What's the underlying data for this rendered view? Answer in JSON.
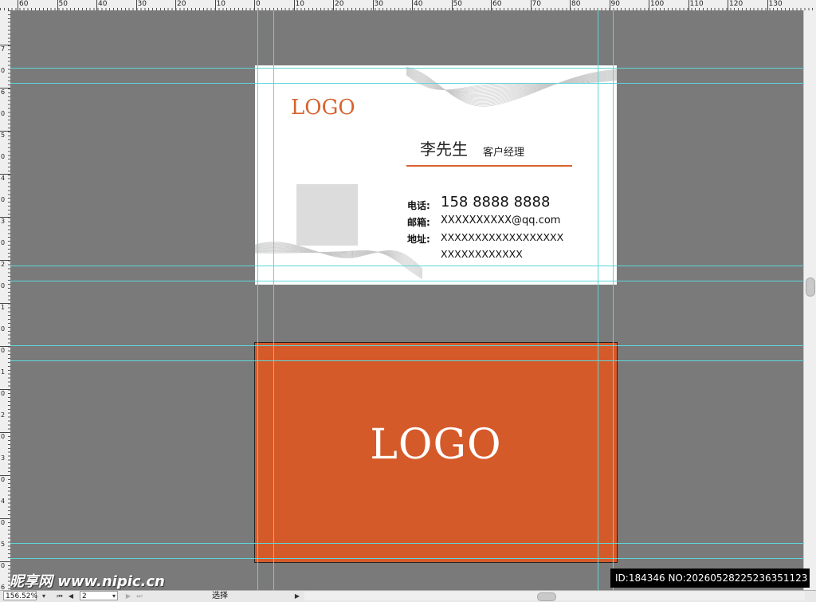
{
  "ruler": {
    "top_numbers": [
      "60",
      "50",
      "40",
      "30",
      "20",
      "10",
      "0",
      "10",
      "20",
      "30",
      "40",
      "50",
      "60",
      "70",
      "80",
      "90",
      "100",
      "110",
      "120",
      "130"
    ],
    "left_numbers": [
      "7",
      "0",
      "6",
      "0",
      "5",
      "0",
      "4",
      "0",
      "3",
      "0",
      "2",
      "0",
      "1",
      "0",
      "0",
      "1",
      "0",
      "2",
      "0",
      "3",
      "0",
      "4",
      "0",
      "5",
      "0",
      "6"
    ]
  },
  "card_front": {
    "logo": "LOGO",
    "name": "李先生",
    "title": "客户经理",
    "phone_label": "电话:",
    "phone": "158 8888 8888",
    "email_label": "邮箱:",
    "email": "XXXXXXXXXX@qq.com",
    "address_label": "地址:",
    "address_line1": "XXXXXXXXXXXXXXXXXX",
    "address_line2": "XXXXXXXXXXXX",
    "accent_color": "#d7632d"
  },
  "card_back": {
    "logo": "LOGO",
    "background_color": "#d55a2a"
  },
  "statusbar": {
    "zoom": "156.52%",
    "page": "2",
    "tool": "选择"
  },
  "watermark": {
    "left": "昵享网 www.nipic.cn",
    "right": "ID:184346 NO:20260528225236351123"
  },
  "colors": {
    "guide": "#5fd5d9",
    "pasteboard": "#7a7a7a"
  }
}
